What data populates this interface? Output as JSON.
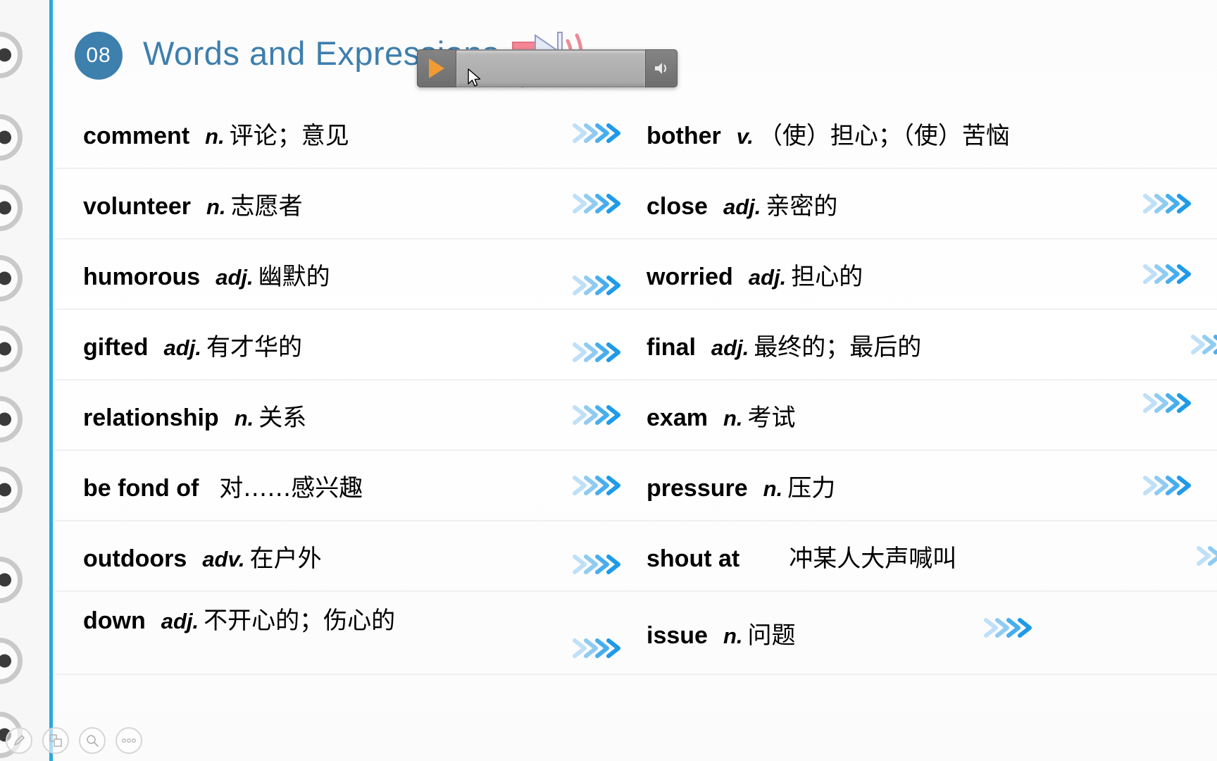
{
  "header": {
    "badge_number": "08",
    "title": "Words and Expressions"
  },
  "player": {
    "play_icon": "play-triangle-icon",
    "volume_icon": "volume-icon",
    "progress_percent": 0
  },
  "decoration": {
    "megaphone_icon": "megaphone-icon"
  },
  "gutter": {
    "audio_bubbles": 8,
    "bubble_icon": "speaker-circle-icon"
  },
  "vocabulary": {
    "rows": [
      {
        "left": {
          "term": "comment",
          "pos": "n.",
          "meaning": "评论；意见"
        },
        "right": {
          "term": "bother",
          "pos": "v.",
          "meaning": "（使）担心；（使）苦恼"
        }
      },
      {
        "left": {
          "term": "volunteer",
          "pos": "n.",
          "meaning": "志愿者"
        },
        "right": {
          "term": "close",
          "pos": "adj.",
          "meaning": "亲密的"
        }
      },
      {
        "left": {
          "term": "humorous",
          "pos": "adj.",
          "meaning": "幽默的"
        },
        "right": {
          "term": "worried",
          "pos": "adj.",
          "meaning": "担心的"
        }
      },
      {
        "left": {
          "term": "gifted",
          "pos": "adj.",
          "meaning": "有才华的"
        },
        "right": {
          "term": "final",
          "pos": "adj.",
          "meaning": "最终的；最后的"
        }
      },
      {
        "left": {
          "term": "relationship",
          "pos": "n.",
          "meaning": "关系"
        },
        "right": {
          "term": "exam",
          "pos": "n.",
          "meaning": "考试"
        }
      },
      {
        "left": {
          "term": "be fond of",
          "pos": "",
          "meaning": "对……感兴趣"
        },
        "right": {
          "term": "pressure",
          "pos": "n.",
          "meaning": "压力"
        }
      },
      {
        "left": {
          "term": "outdoors",
          "pos": "adv.",
          "meaning": "在户外"
        },
        "right": {
          "term": "shout at",
          "pos": "",
          "meaning": "冲某人大声喊叫"
        }
      },
      {
        "left": {
          "term": "down",
          "pos": "adj.",
          "meaning": "不开心的；伤心的"
        },
        "right": {
          "term": "issue",
          "pos": "n.",
          "meaning": "问题"
        }
      }
    ],
    "play_chevron_icon": "chevron-play-icon"
  },
  "toolbar": {
    "items": [
      {
        "icon": "pen-icon",
        "label": "pen"
      },
      {
        "icon": "layers-icon",
        "label": "layers"
      },
      {
        "icon": "magnifier-icon",
        "label": "zoom"
      },
      {
        "icon": "more-icon",
        "label": "more"
      }
    ]
  },
  "colors": {
    "accent_blue": "#3d7fad",
    "rule_blue": "#29a8e0",
    "chevron_blue": "#1e9ae8",
    "play_orange": "#f29a33"
  }
}
